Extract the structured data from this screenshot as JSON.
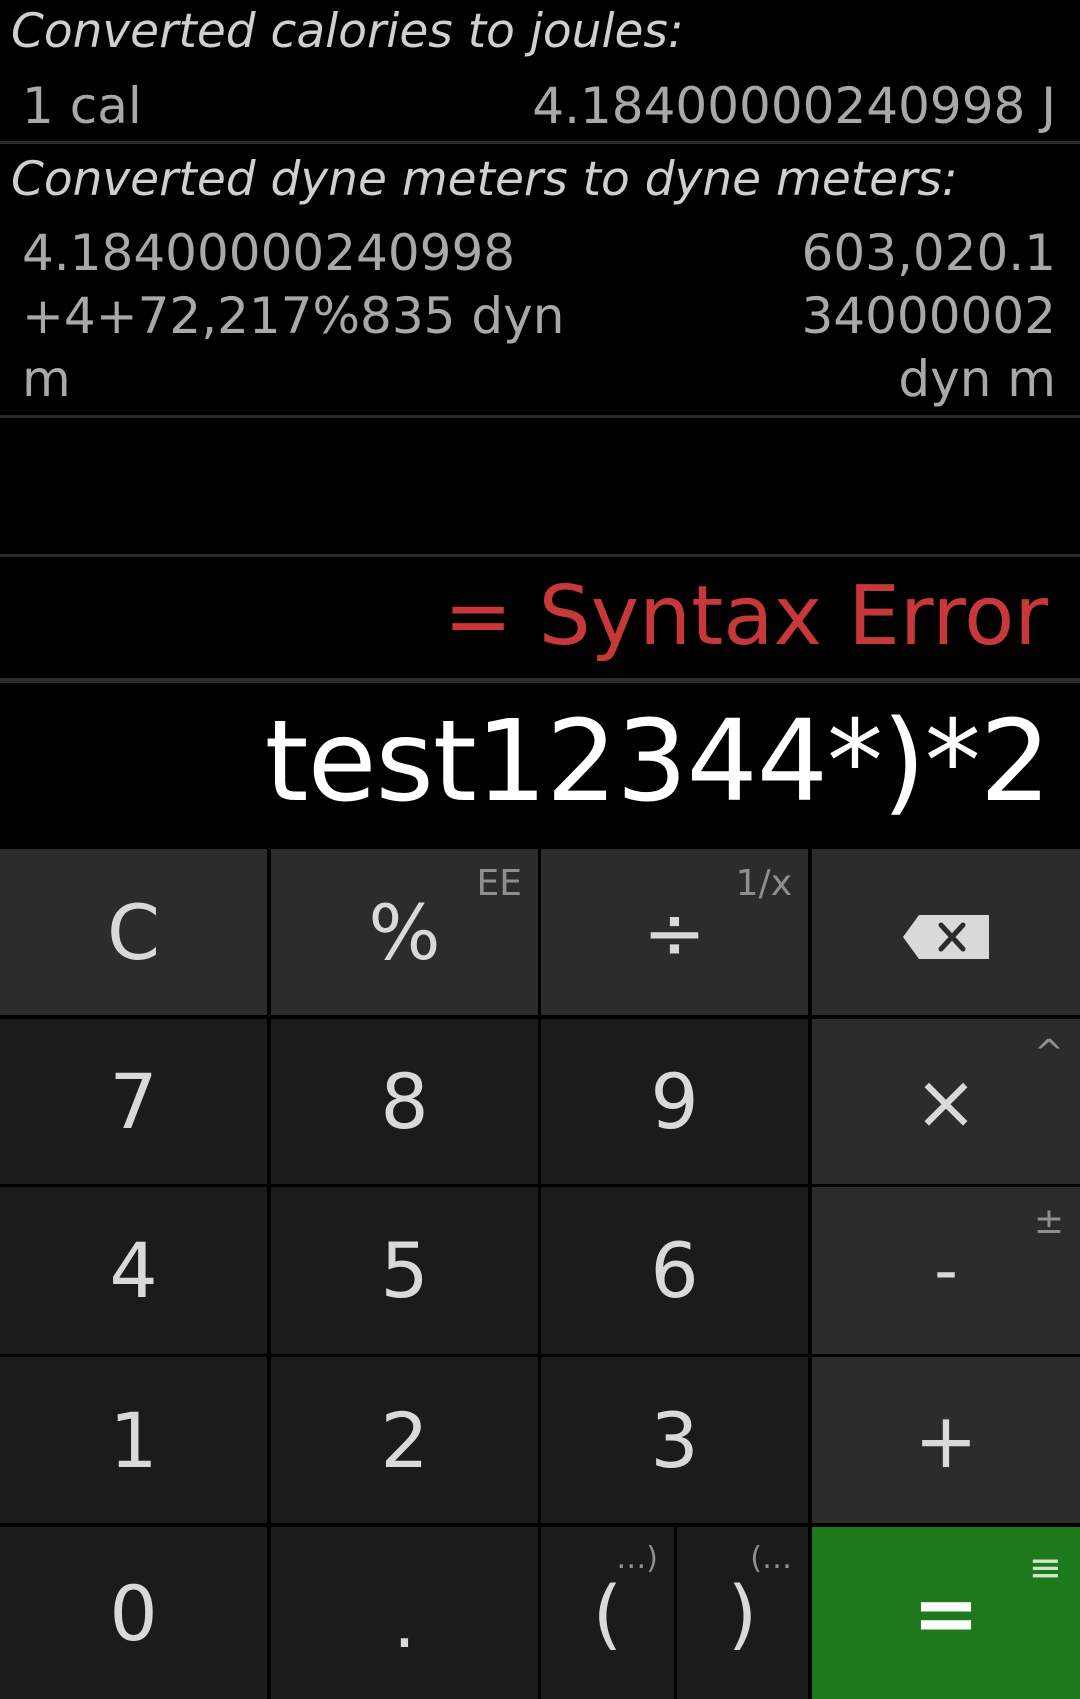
{
  "history": {
    "entries": [
      {
        "title": "Converted calories to joules:",
        "left": "1 cal",
        "right": "4.18400000240998 J"
      },
      {
        "title": "Converted dyne meters to dyne meters:",
        "left": "4.18400000240998\n+4+72,217%835 dyn\nm",
        "right": "603,020.1\n34000002\ndyn m"
      }
    ]
  },
  "result": {
    "text": "= Syntax Error",
    "color": "#c8383b"
  },
  "expression": {
    "text": "test12344*)*2"
  },
  "keypad": {
    "rows": [
      [
        {
          "label": "C",
          "sub": "",
          "name": "clear-button",
          "style": "op"
        },
        {
          "label": "%",
          "sub": "EE",
          "name": "percent-button",
          "style": "op"
        },
        {
          "label": "÷",
          "sub": "1/x",
          "name": "divide-button",
          "style": "op"
        },
        {
          "label": "",
          "sub": "",
          "name": "backspace-button",
          "style": "op",
          "icon": "backspace-icon"
        }
      ],
      [
        {
          "label": "7",
          "sub": "",
          "name": "digit-7-button",
          "style": "num"
        },
        {
          "label": "8",
          "sub": "",
          "name": "digit-8-button",
          "style": "num"
        },
        {
          "label": "9",
          "sub": "",
          "name": "digit-9-button",
          "style": "num"
        },
        {
          "label": "×",
          "sub": "^",
          "name": "multiply-button",
          "style": "op"
        }
      ],
      [
        {
          "label": "4",
          "sub": "",
          "name": "digit-4-button",
          "style": "num"
        },
        {
          "label": "5",
          "sub": "",
          "name": "digit-5-button",
          "style": "num"
        },
        {
          "label": "6",
          "sub": "",
          "name": "digit-6-button",
          "style": "num"
        },
        {
          "label": "-",
          "sub": "±",
          "name": "minus-button",
          "style": "op"
        }
      ],
      [
        {
          "label": "1",
          "sub": "",
          "name": "digit-1-button",
          "style": "num"
        },
        {
          "label": "2",
          "sub": "",
          "name": "digit-2-button",
          "style": "num"
        },
        {
          "label": "3",
          "sub": "",
          "name": "digit-3-button",
          "style": "num"
        },
        {
          "label": "+",
          "sub": "",
          "name": "plus-button",
          "style": "op"
        }
      ],
      [
        {
          "label": "0",
          "sub": "",
          "name": "digit-0-button",
          "style": "num"
        },
        {
          "label": ".",
          "sub": "",
          "name": "decimal-point-button",
          "style": "num"
        },
        {
          "label": "(",
          "sub": "…)",
          "name": "open-paren-button",
          "style": "num"
        },
        {
          "label": ")",
          "sub": "(…",
          "name": "close-paren-button",
          "style": "num"
        },
        {
          "label": "=",
          "sub": "≡",
          "name": "equals-button",
          "style": "eq"
        }
      ]
    ],
    "colors": {
      "number_key": "#1b1b1b",
      "operator_key": "#2c2c2c",
      "equals_key": "#1c7a1c"
    }
  }
}
